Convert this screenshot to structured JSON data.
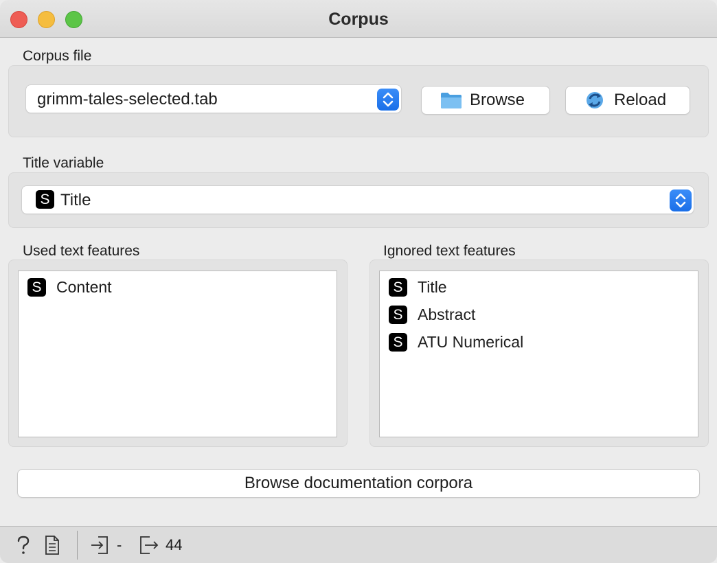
{
  "window": {
    "title": "Corpus"
  },
  "corpus_file": {
    "label": "Corpus file",
    "selected_file": "grimm-tales-selected.tab",
    "browse_label": "Browse",
    "reload_label": "Reload"
  },
  "title_variable": {
    "label": "Title variable",
    "type_badge": "S",
    "selected": "Title"
  },
  "used_features": {
    "label": "Used text features",
    "items": [
      {
        "badge": "S",
        "name": "Content"
      }
    ]
  },
  "ignored_features": {
    "label": "Ignored text features",
    "items": [
      {
        "badge": "S",
        "name": "Title"
      },
      {
        "badge": "S",
        "name": "Abstract"
      },
      {
        "badge": "S",
        "name": "ATU Numerical"
      }
    ]
  },
  "documentation_button": {
    "label": "Browse documentation corpora"
  },
  "status": {
    "input_value": "-",
    "output_value": "44"
  },
  "colors": {
    "accent": "#1a6fe8",
    "close": "#ee5d55",
    "minimize": "#f5bd3f",
    "maximize": "#5cc547"
  },
  "icons": {
    "help": "question-mark-icon",
    "report": "document-icon",
    "input": "input-arrow-icon",
    "output": "output-arrow-icon",
    "folder": "folder-icon",
    "reload": "reload-icon"
  }
}
